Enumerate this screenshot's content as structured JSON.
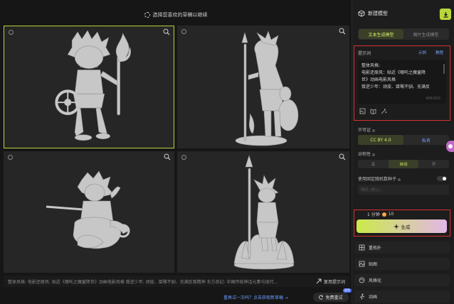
{
  "gallery": {
    "hint": "选择您喜欢的草稿以继续",
    "prompt_text": "整体风格: 电影还原风: 贴近《哪吒之魔童降世》动画电影风格 叛逆少年: 顽皮、桀骜不驯、充满反叛精神 东方奇幻: 中国传统神话元素与现代...",
    "copy_label": "复用提示词",
    "retry_text": "重再试一次吗？点击获取新草稿 →",
    "free_try_label": "免费重试",
    "free_badge": "限免"
  },
  "panel": {
    "title": "新建模型",
    "close": "×",
    "tabs": [
      {
        "label": "文本生成模型",
        "active": true
      },
      {
        "label": "图片生成模型",
        "active": false
      }
    ],
    "prompt_label": "提示词",
    "example_link": "示例",
    "tutorial_link": "教程",
    "prompt_lines": [
      "整体风格:",
      "电影还原风：贴近《哪吒之魔童降",
      "世》动画电影风格",
      "叛逆少年：顽皮、桀骜不驯、充满反"
    ],
    "prompt_count": "488/500",
    "license_label": "许可证",
    "license_options": [
      {
        "label": "CC BY 4.0",
        "active": true
      },
      {
        "label": "私有",
        "active": false
      }
    ],
    "symmetry_label": "对称性",
    "symmetry_options": [
      {
        "label": "关",
        "active": false
      },
      {
        "label": "自动",
        "active": true
      },
      {
        "label": "开",
        "active": false
      }
    ],
    "seed_label": "使用固定随机数种子",
    "seed_placeholder": "随机 (默认)",
    "cost_time": "1 分钟",
    "cost_coins": "10",
    "generate_label": "生成",
    "accordion": [
      "重拓扑",
      "贴图",
      "风格化",
      "动画"
    ]
  },
  "colors": {
    "accent": "#b9d63b",
    "highlight": "#d93030",
    "link": "#7aa4ff"
  }
}
